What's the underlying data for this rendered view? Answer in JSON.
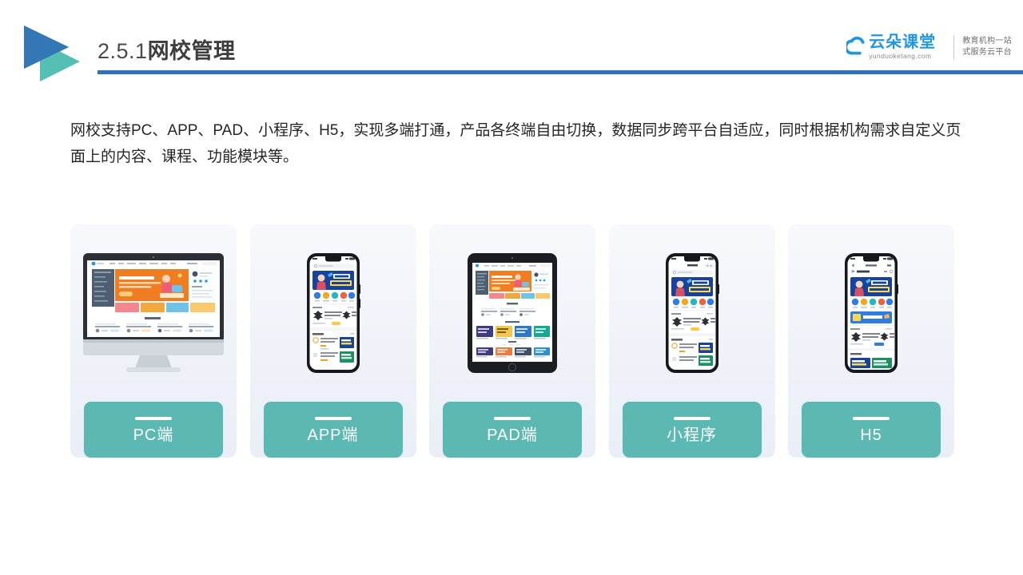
{
  "header": {
    "number": "2.5.1",
    "title_cn": "网校管理",
    "logo_icon": "double-triangle-play-icon",
    "rule_color": "#2f74b5"
  },
  "brand": {
    "cloud_icon": "cloud-icon",
    "name": "云朵课堂",
    "domain": "yunduoketang.com",
    "tagline": "教育机构一站\n式服务云平台",
    "accent_color": "#2196e3"
  },
  "intro": {
    "paragraph": "网校支持PC、APP、PAD、小程序、H5，实现多端打通，产品各终端自由切换，数据同步跨平台自适应，同时根据机构需求自定义页面上的内容、课程、功能模块等。"
  },
  "cards": [
    {
      "id": "pc",
      "label": "PC端",
      "device": "desktop-monitor-icon",
      "pill_color": "#5cb8b3"
    },
    {
      "id": "app",
      "label": "APP端",
      "device": "smartphone-icon",
      "pill_color": "#5cb8b3"
    },
    {
      "id": "pad",
      "label": "PAD端",
      "device": "tablet-icon",
      "pill_color": "#5cb8b3"
    },
    {
      "id": "miniapp",
      "label": "小程序",
      "device": "smartphone-icon",
      "pill_color": "#5cb8b3"
    },
    {
      "id": "h5",
      "label": "H5",
      "device": "smartphone-icon",
      "pill_color": "#5cb8b3"
    }
  ],
  "device_screens": {
    "desktop": {
      "site_logo": "云朵",
      "hero_headline": "加入云朵·16业领域课程",
      "section_title": "公开课"
    },
    "phone": {
      "banner_line1": "职场人的",
      "banner_line2": "第一堂沟通课",
      "section_title": "推荐课程"
    },
    "tablet": {
      "section_title": "公开课"
    }
  }
}
